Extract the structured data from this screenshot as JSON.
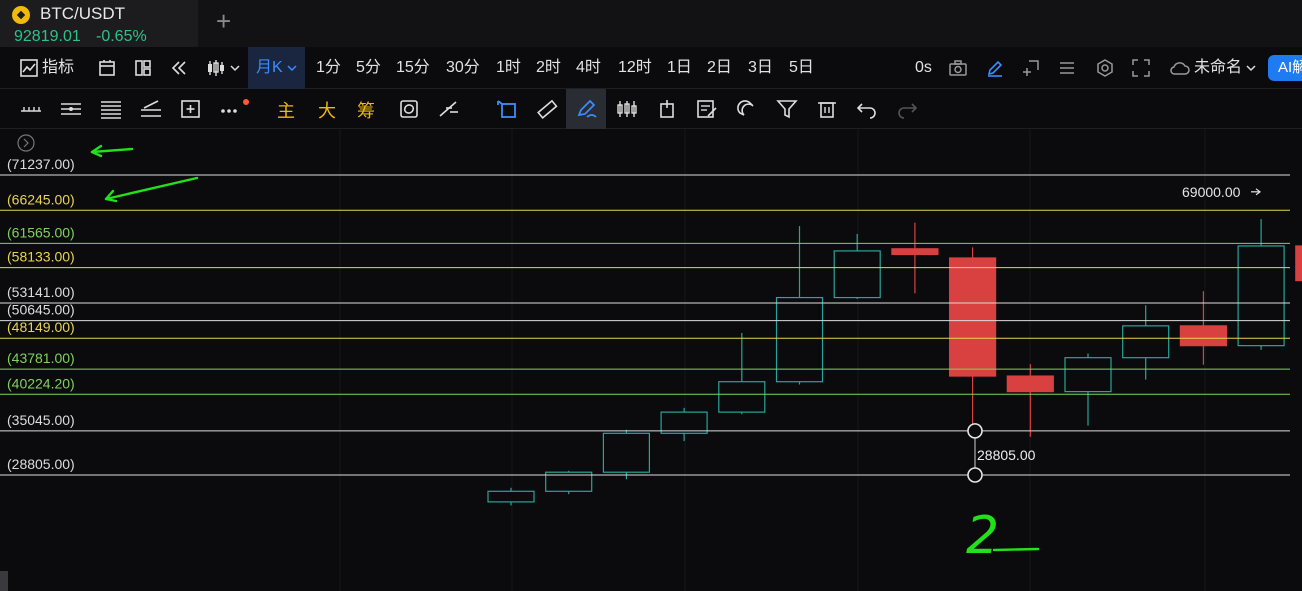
{
  "tab": {
    "title": "BTC/USDT",
    "price": "92819.01",
    "change": "-0.65%",
    "add": "+"
  },
  "toolbar": {
    "indicators": "指标",
    "interval_active": "月K",
    "intervals": [
      "1分",
      "5分",
      "15分",
      "30分",
      "1时",
      "2时",
      "4时",
      "12时",
      "1日",
      "2日",
      "3日",
      "5日"
    ],
    "timer": "0s",
    "layout_name": "未命名",
    "ai": "AI解"
  },
  "drawing_tools": {
    "main": "主",
    "big": "大",
    "chip": "筹"
  },
  "colors": {
    "up": "#26a69a",
    "down": "#d94040",
    "white_line": "#dcdcdc",
    "yellow_line": "#e8d44d",
    "green_line": "#7fd35a",
    "annotation": "#22e11a"
  },
  "chart_data": {
    "type": "candlestick",
    "interval": "月K",
    "levels": [
      {
        "label": "(71237.00)",
        "value": 71237,
        "color": "white"
      },
      {
        "label": "(66245.00)",
        "value": 66245,
        "color": "yellow"
      },
      {
        "label": "(61565.00)",
        "value": 61565,
        "color": "green"
      },
      {
        "label": "(58133.00)",
        "value": 58133,
        "color": "yellow"
      },
      {
        "label": "(53141.00)",
        "value": 53141,
        "color": "white"
      },
      {
        "label": "(50645.00)",
        "value": 50645,
        "color": "white"
      },
      {
        "label": "(48149.00)",
        "value": 48149,
        "color": "yellow"
      },
      {
        "label": "(43781.00)",
        "value": 43781,
        "color": "green"
      },
      {
        "label": "(40224.20)",
        "value": 40224.2,
        "color": "green"
      },
      {
        "label": "(35045.00)",
        "value": 35045,
        "color": "white"
      },
      {
        "label": "(28805.00)",
        "value": 28805,
        "color": "white"
      }
    ],
    "candles": [
      {
        "open": 25000,
        "close": 26500,
        "high": 27000,
        "low": 24500
      },
      {
        "open": 26500,
        "close": 29200,
        "high": 29400,
        "low": 26100
      },
      {
        "open": 29200,
        "close": 34700,
        "high": 35200,
        "low": 28200
      },
      {
        "open": 34700,
        "close": 37700,
        "high": 38300,
        "low": 33600
      },
      {
        "open": 37700,
        "close": 42000,
        "high": 48900,
        "low": 37400
      },
      {
        "open": 42000,
        "close": 53900,
        "high": 64000,
        "low": 41600
      },
      {
        "open": 53900,
        "close": 60500,
        "high": 62900,
        "low": 53700
      },
      {
        "open": 60800,
        "close": 60000,
        "high": 64500,
        "low": 54500
      },
      {
        "open": 59500,
        "close": 42800,
        "high": 61000,
        "low": 34400
      },
      {
        "open": 42800,
        "close": 40600,
        "high": 44500,
        "low": 34200
      },
      {
        "open": 40600,
        "close": 45400,
        "high": 46000,
        "low": 35800
      },
      {
        "open": 45400,
        "close": 49900,
        "high": 52800,
        "low": 42300
      },
      {
        "open": 49900,
        "close": 47100,
        "high": 54800,
        "low": 44400
      },
      {
        "open": 47100,
        "close": 61200,
        "high": 65000,
        "low": 46500
      },
      {
        "open": 61200,
        "close": 56300,
        "high": 67100,
        "low": 52200
      }
    ],
    "price_labels": [
      "69000.00",
      "28805.00"
    ],
    "price_label_values": [
      69000,
      28805
    ],
    "annotation_text": "2"
  }
}
